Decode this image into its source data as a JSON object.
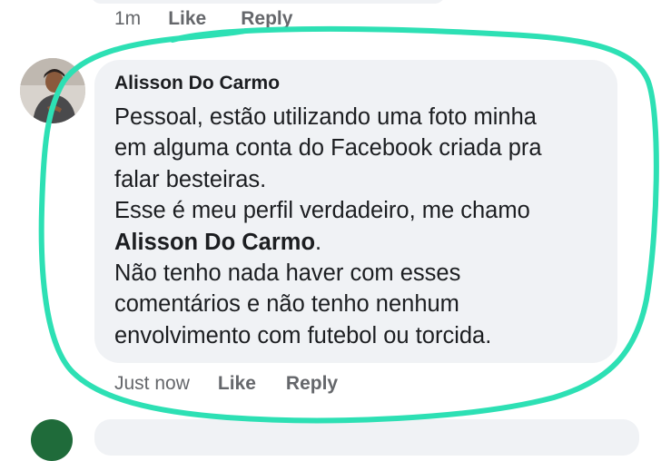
{
  "previous_comment": {
    "time": "1m",
    "like_label": "Like",
    "reply_label": "Reply"
  },
  "comment": {
    "author": "Alisson Do Carmo",
    "lines": [
      "Pessoal, estão utilizando uma foto minha",
      "em alguma conta do Facebook criada pra",
      "falar besteiras.",
      "Esse é meu perfil verdadeiro, me chamo"
    ],
    "bold_name": "Alisson Do Carmo",
    "bold_suffix": ".",
    "lines_after": [
      "Não tenho nada haver com esses",
      "comentários e não tenho nenhum",
      "envolvimento com futebol ou torcida."
    ],
    "time": "Just now",
    "like_label": "Like",
    "reply_label": "Reply"
  },
  "annotation": {
    "marker_color": "#2de0b4"
  }
}
